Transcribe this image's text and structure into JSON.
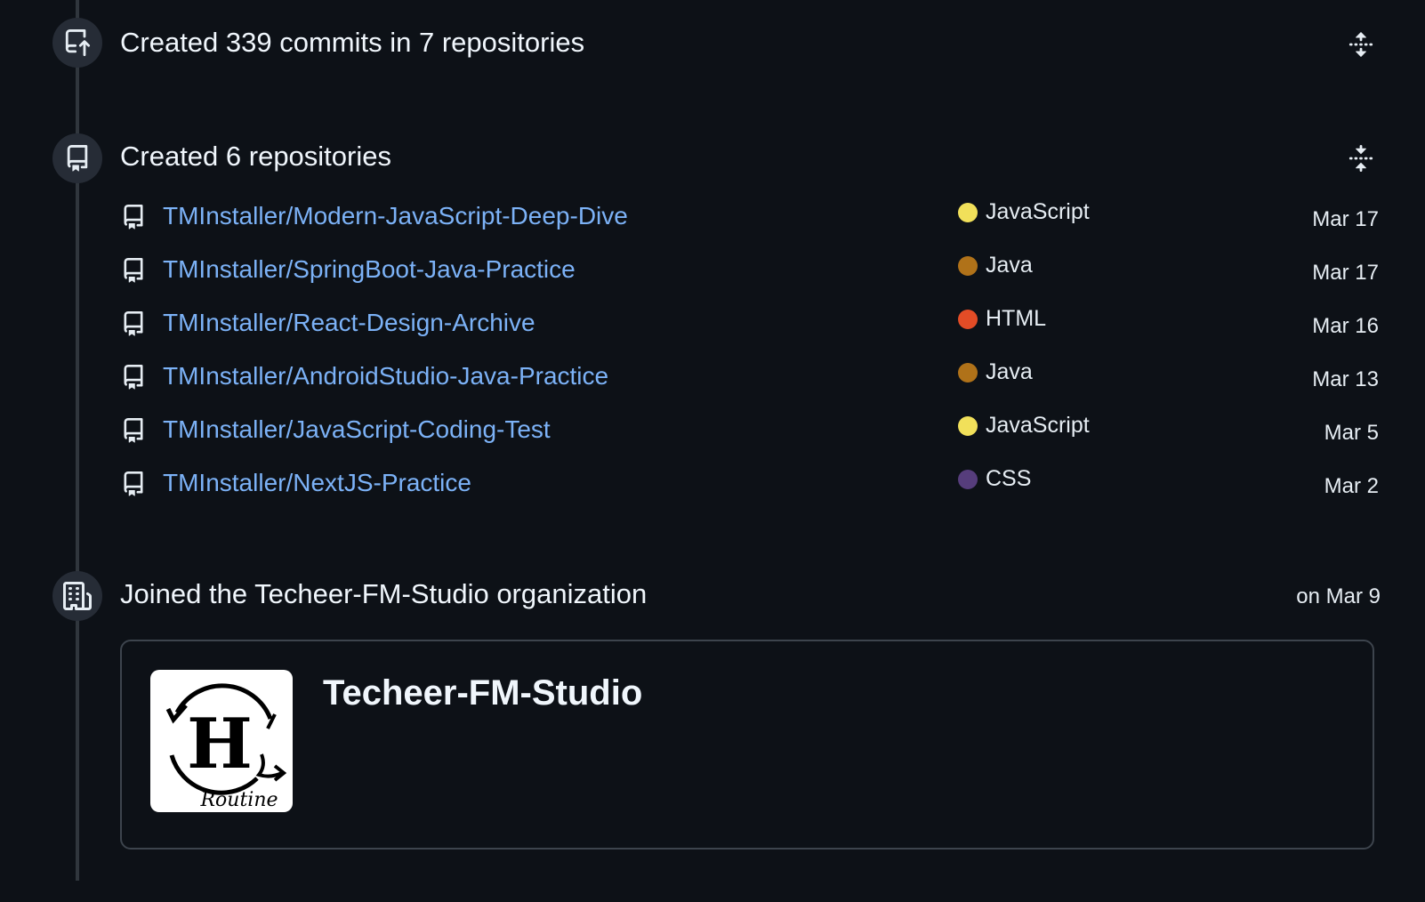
{
  "commits_section": {
    "title": "Created 339 commits in 7 repositories",
    "icon": "repo-push-icon",
    "toggle_icon": "unfold-icon"
  },
  "repos_section": {
    "title": "Created 6 repositories",
    "icon": "repo-icon",
    "toggle_icon": "fold-icon",
    "repos": [
      {
        "name": "TMInstaller/Modern-JavaScript-Deep-Dive",
        "language": "JavaScript",
        "language_color": "#f1e05a",
        "date": "Mar 17"
      },
      {
        "name": "TMInstaller/SpringBoot-Java-Practice",
        "language": "Java",
        "language_color": "#b07219",
        "date": "Mar 17"
      },
      {
        "name": "TMInstaller/React-Design-Archive",
        "language": "HTML",
        "language_color": "#e34c26",
        "date": "Mar 16"
      },
      {
        "name": "TMInstaller/AndroidStudio-Java-Practice",
        "language": "Java",
        "language_color": "#b07219",
        "date": "Mar 13"
      },
      {
        "name": "TMInstaller/JavaScript-Coding-Test",
        "language": "JavaScript",
        "language_color": "#f1e05a",
        "date": "Mar 5"
      },
      {
        "name": "TMInstaller/NextJS-Practice",
        "language": "CSS",
        "language_color": "#563d7c",
        "date": "Mar 2"
      }
    ]
  },
  "org_section": {
    "title": "Joined the Techeer-FM-Studio organization",
    "icon": "organization-icon",
    "date": "on Mar 9",
    "org_name": "Techeer-FM-Studio",
    "logo_text": "Routine",
    "logo_letter": "H"
  }
}
